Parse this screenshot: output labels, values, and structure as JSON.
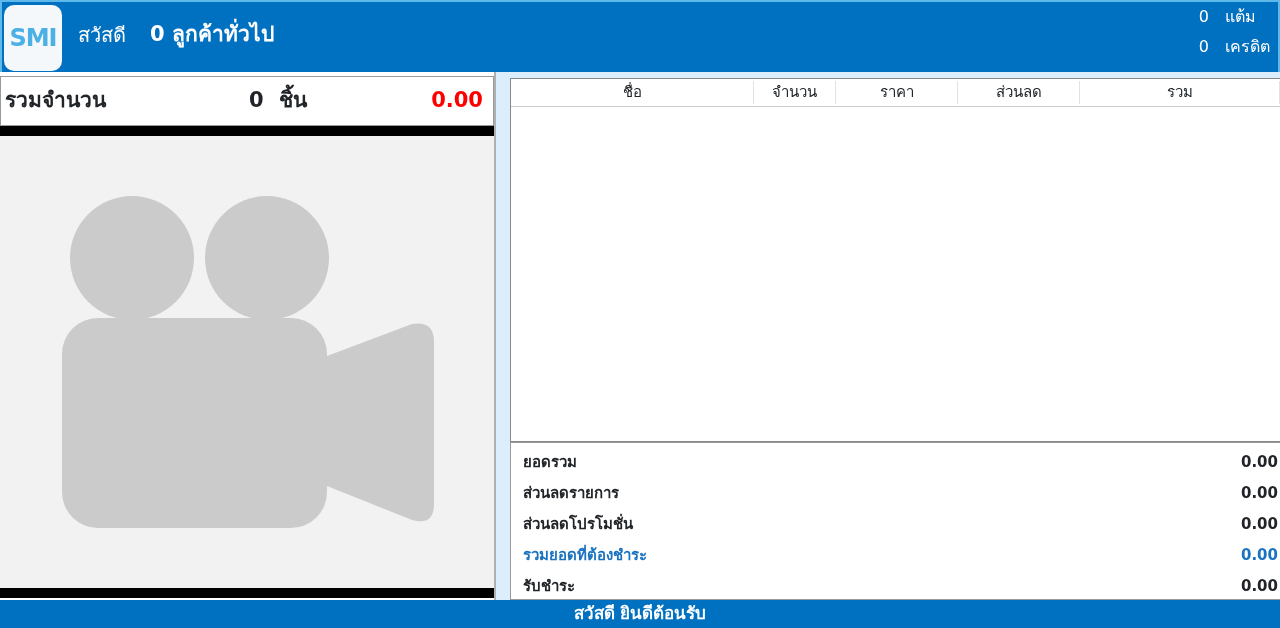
{
  "header": {
    "logo": "SMI",
    "greeting": "สวัสดี",
    "customer_code": "0",
    "customer_name": "ลูกค้าทั่วไป",
    "points": {
      "value": "0",
      "label": "แต้ม"
    },
    "credit": {
      "value": "0",
      "label": "เครดิต"
    }
  },
  "left_panel": {
    "total_label": "รวมจำนวน",
    "quantity": "0",
    "unit": "ชิ้น",
    "amount": "0.00"
  },
  "table": {
    "columns": [
      "ชื่อ",
      "จำนวน",
      "ราคา",
      "ส่วนลด",
      "รวม"
    ]
  },
  "summary": [
    {
      "label": "ยอดรวม",
      "value": "0.00",
      "kind": "normal"
    },
    {
      "label": "ส่วนลดรายการ",
      "value": "0.00",
      "kind": "normal"
    },
    {
      "label": "ส่วนลดโปรโมชั่น",
      "value": "0.00",
      "kind": "normal"
    },
    {
      "label": "รวมยอดที่ต้องชำระ",
      "value": "0.00",
      "kind": "due"
    },
    {
      "label": "รับชำระ",
      "value": "0.00",
      "kind": "normal"
    }
  ],
  "status_bar": "สวัสดี ยินดีต้อนรับ"
}
